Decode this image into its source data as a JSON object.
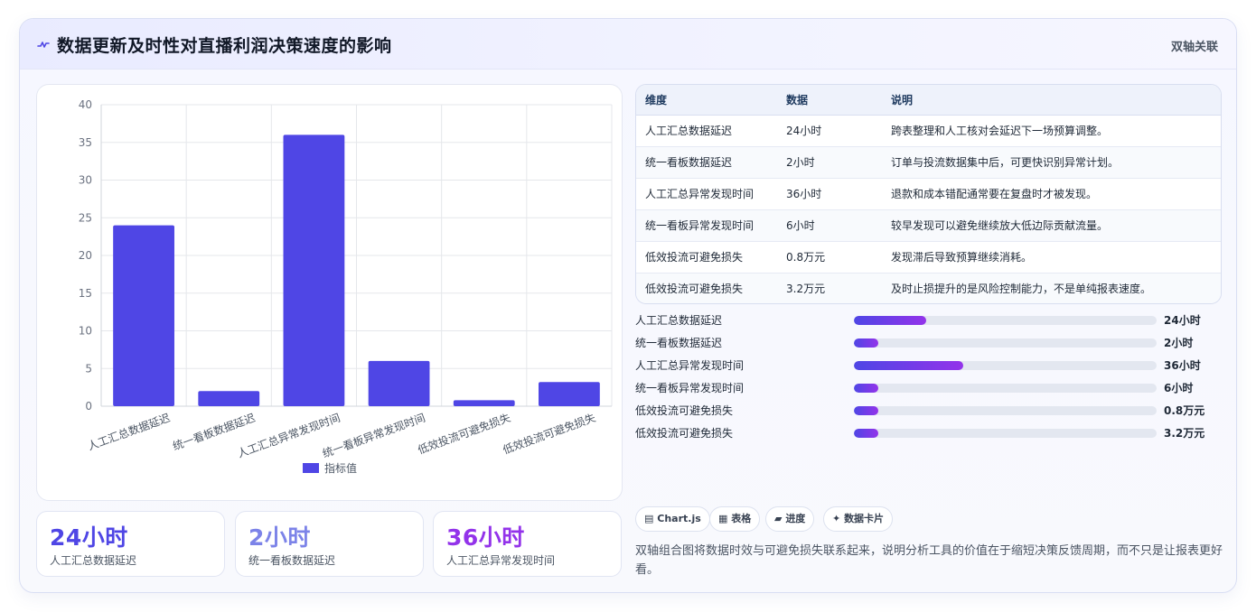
{
  "header": {
    "title": "数据更新及时性对直播利润决策速度的影响",
    "tag": "双轴关联",
    "icon": "pulse-icon"
  },
  "chart_data": {
    "type": "bar",
    "categories": [
      "人工汇总数据延迟",
      "统一看板数据延迟",
      "人工汇总异常发现时间",
      "统一看板异常发现时间",
      "低效投流可避免损失",
      "低效投流可避免损失"
    ],
    "series": [
      {
        "name": "指标值",
        "values": [
          24,
          2,
          36,
          6,
          0.8,
          3.2
        ],
        "color": "#4f46e5"
      }
    ],
    "ylim": [
      0,
      40
    ],
    "yticks": [
      0,
      5,
      10,
      15,
      20,
      25,
      30,
      35,
      40
    ],
    "grid": true,
    "legend": "bottom"
  },
  "kpis": [
    {
      "value": "24小时",
      "label": "人工汇总数据延迟",
      "color": "#4f46e5"
    },
    {
      "value": "2小时",
      "label": "统一看板数据延迟",
      "color": "#7c83e8"
    },
    {
      "value": "36小时",
      "label": "人工汇总异常发现时间",
      "color": "#9333ea"
    }
  ],
  "table": {
    "headers": [
      "维度",
      "数据",
      "说明"
    ],
    "rows": [
      [
        "人工汇总数据延迟",
        "24小时",
        "跨表整理和人工核对会延迟下一场预算调整。"
      ],
      [
        "统一看板数据延迟",
        "2小时",
        "订单与投流数据集中后，可更快识别异常计划。"
      ],
      [
        "人工汇总异常发现时间",
        "36小时",
        "退款和成本错配通常要在复盘时才被发现。"
      ],
      [
        "统一看板异常发现时间",
        "6小时",
        "较早发现可以避免继续放大低边际贡献流量。"
      ],
      [
        "低效投流可避免损失",
        "0.8万元",
        "发现滞后导致预算继续消耗。"
      ],
      [
        "低效投流可避免损失",
        "3.2万元",
        "及时止损提升的是风险控制能力，不是单纯报表速度。"
      ]
    ]
  },
  "progress": [
    {
      "label": "人工汇总数据延迟",
      "value": "24小时",
      "fraction": 0.24
    },
    {
      "label": "统一看板数据延迟",
      "value": "2小时",
      "fraction": 0.08
    },
    {
      "label": "人工汇总异常发现时间",
      "value": "36小时",
      "fraction": 0.36
    },
    {
      "label": "统一看板异常发现时间",
      "value": "6小时",
      "fraction": 0.08
    },
    {
      "label": "低效投流可避免损失",
      "value": "0.8万元",
      "fraction": 0.08
    },
    {
      "label": "低效投流可避免损失",
      "value": "3.2万元",
      "fraction": 0.08
    }
  ],
  "chips": [
    {
      "icon": "chart-icon",
      "glyph": "▤",
      "label": "Chart.js"
    },
    {
      "icon": "table-icon",
      "glyph": "▦",
      "label": "表格"
    },
    {
      "icon": "progress-icon",
      "glyph": "▰",
      "label": "进度"
    },
    {
      "icon": "sparkle-icon",
      "glyph": "✦",
      "label": "数据卡片"
    }
  ],
  "note": "双轴组合图将数据时效与可避免损失联系起来，说明分析工具的价值在于缩短决策反馈周期，而不只是让报表更好看。"
}
